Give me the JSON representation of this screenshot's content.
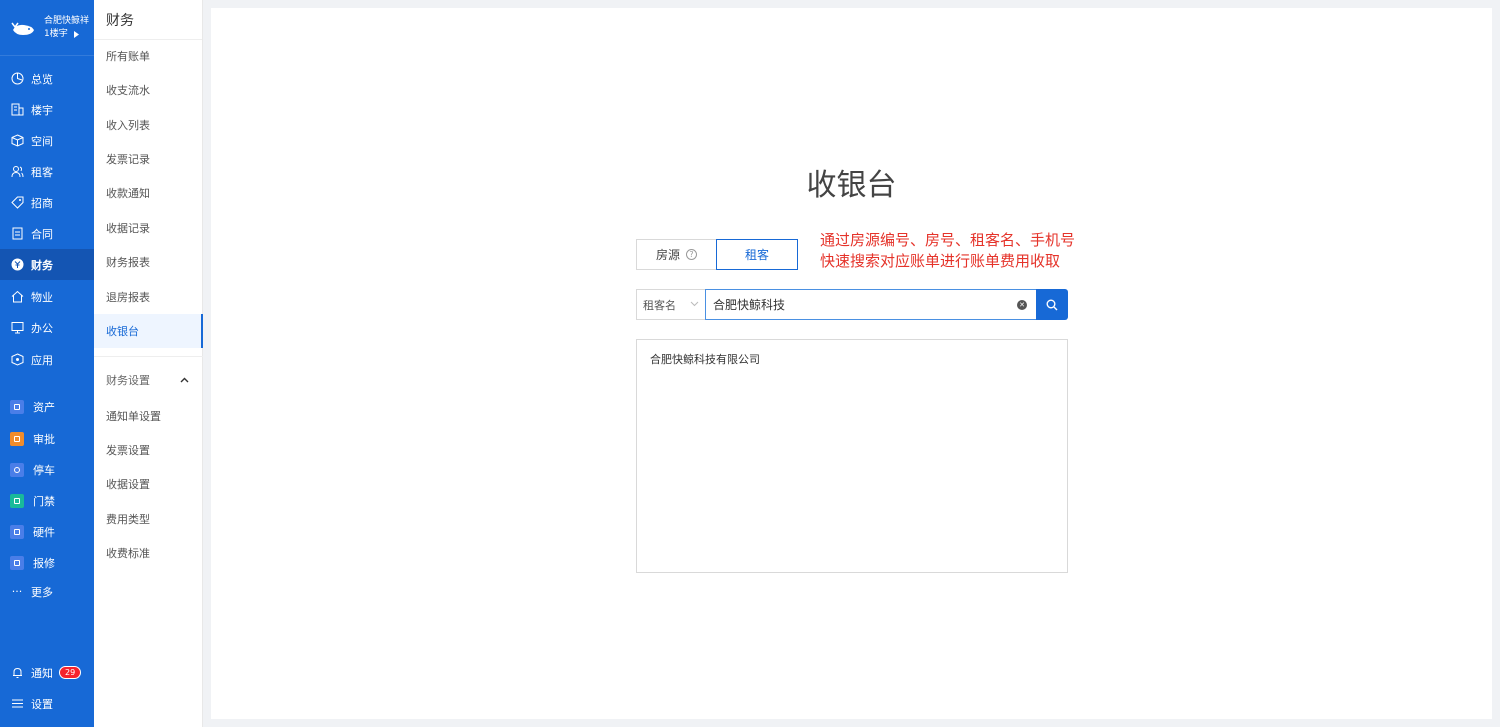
{
  "brand": {
    "name": "合肥快鲸祥",
    "building": "1楼宇"
  },
  "leftnav": {
    "items": [
      {
        "label": "总览",
        "icon": "dashboard-icon"
      },
      {
        "label": "楼宇",
        "icon": "building-icon"
      },
      {
        "label": "空间",
        "icon": "cube-icon"
      },
      {
        "label": "租客",
        "icon": "users-icon"
      },
      {
        "label": "招商",
        "icon": "tag-icon"
      },
      {
        "label": "合同",
        "icon": "document-icon"
      },
      {
        "label": "财务",
        "icon": "finance-icon",
        "active": true
      },
      {
        "label": "物业",
        "icon": "home-icon"
      },
      {
        "label": "办公",
        "icon": "monitor-icon"
      },
      {
        "label": "应用",
        "icon": "apps-icon"
      }
    ],
    "apps": [
      {
        "label": "资产",
        "color": "#4a7ee8"
      },
      {
        "label": "审批",
        "color": "#f08c2c"
      },
      {
        "label": "停车",
        "color": "#4a7ee8"
      },
      {
        "label": "门禁",
        "color": "#19b99a"
      },
      {
        "label": "硬件",
        "color": "#4a7ee8"
      },
      {
        "label": "报修",
        "color": "#4a7ee8"
      }
    ],
    "more": "更多",
    "notify": {
      "label": "通知",
      "count": "29"
    },
    "settings": "设置"
  },
  "subnav": {
    "title": "财务",
    "items": [
      "所有账单",
      "收支流水",
      "收入列表",
      "发票记录",
      "收款通知",
      "收据记录",
      "财务报表",
      "退房报表",
      "收银台"
    ],
    "active": "收银台",
    "group_label": "财务设置",
    "group_items": [
      "通知单设置",
      "发票设置",
      "收据设置",
      "费用类型",
      "收费标准"
    ]
  },
  "main": {
    "title": "收银台",
    "tabs": {
      "fangyuan": "房源",
      "zuke": "租客"
    },
    "annotation": [
      "通过房源编号、房号、租客名、手机号",
      "快速搜索对应账单进行账单费用收取"
    ],
    "search": {
      "type": "租客名",
      "value": "合肥快鲸科技"
    },
    "results": [
      "合肥快鲸科技有限公司"
    ]
  }
}
